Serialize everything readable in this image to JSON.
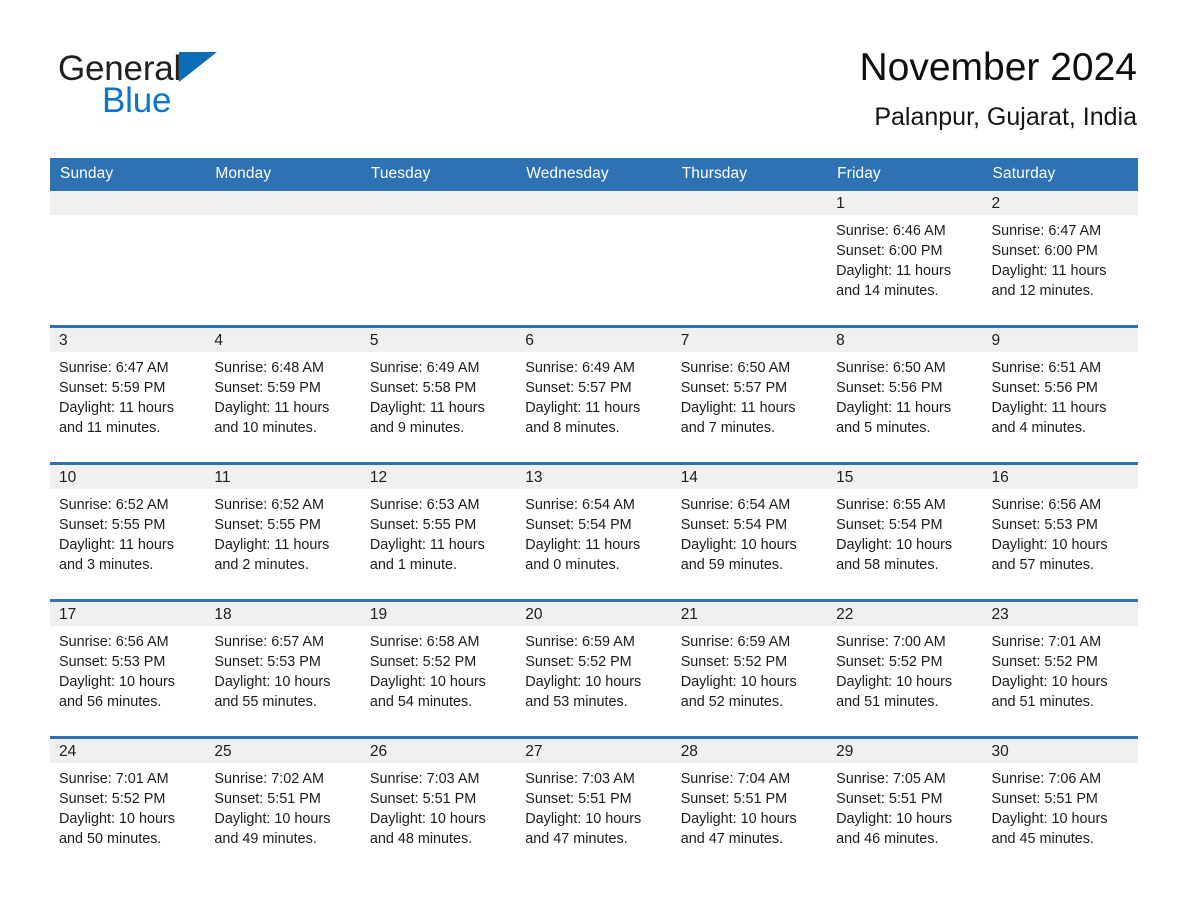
{
  "logo": {
    "word1": "General",
    "word2": "Blue",
    "triangle_icon": "triangle-icon",
    "color_black": "#231f20",
    "color_blue": "#0b76cf"
  },
  "header": {
    "title": "November 2024",
    "subtitle": "Palanpur, Gujarat, India"
  },
  "theme": {
    "header_blue": "#2f72b4",
    "daystrip_gray": "#f0f0f0",
    "text": "#1c1c1c"
  },
  "weekday_headers": [
    "Sunday",
    "Monday",
    "Tuesday",
    "Wednesday",
    "Thursday",
    "Friday",
    "Saturday"
  ],
  "weeks": [
    [
      {
        "day": "",
        "lines": []
      },
      {
        "day": "",
        "lines": []
      },
      {
        "day": "",
        "lines": []
      },
      {
        "day": "",
        "lines": []
      },
      {
        "day": "",
        "lines": []
      },
      {
        "day": "1",
        "lines": [
          "Sunrise: 6:46 AM",
          "Sunset: 6:00 PM",
          "Daylight: 11 hours",
          "and 14 minutes."
        ]
      },
      {
        "day": "2",
        "lines": [
          "Sunrise: 6:47 AM",
          "Sunset: 6:00 PM",
          "Daylight: 11 hours",
          "and 12 minutes."
        ]
      }
    ],
    [
      {
        "day": "3",
        "lines": [
          "Sunrise: 6:47 AM",
          "Sunset: 5:59 PM",
          "Daylight: 11 hours",
          "and 11 minutes."
        ]
      },
      {
        "day": "4",
        "lines": [
          "Sunrise: 6:48 AM",
          "Sunset: 5:59 PM",
          "Daylight: 11 hours",
          "and 10 minutes."
        ]
      },
      {
        "day": "5",
        "lines": [
          "Sunrise: 6:49 AM",
          "Sunset: 5:58 PM",
          "Daylight: 11 hours",
          "and 9 minutes."
        ]
      },
      {
        "day": "6",
        "lines": [
          "Sunrise: 6:49 AM",
          "Sunset: 5:57 PM",
          "Daylight: 11 hours",
          "and 8 minutes."
        ]
      },
      {
        "day": "7",
        "lines": [
          "Sunrise: 6:50 AM",
          "Sunset: 5:57 PM",
          "Daylight: 11 hours",
          "and 7 minutes."
        ]
      },
      {
        "day": "8",
        "lines": [
          "Sunrise: 6:50 AM",
          "Sunset: 5:56 PM",
          "Daylight: 11 hours",
          "and 5 minutes."
        ]
      },
      {
        "day": "9",
        "lines": [
          "Sunrise: 6:51 AM",
          "Sunset: 5:56 PM",
          "Daylight: 11 hours",
          "and 4 minutes."
        ]
      }
    ],
    [
      {
        "day": "10",
        "lines": [
          "Sunrise: 6:52 AM",
          "Sunset: 5:55 PM",
          "Daylight: 11 hours",
          "and 3 minutes."
        ]
      },
      {
        "day": "11",
        "lines": [
          "Sunrise: 6:52 AM",
          "Sunset: 5:55 PM",
          "Daylight: 11 hours",
          "and 2 minutes."
        ]
      },
      {
        "day": "12",
        "lines": [
          "Sunrise: 6:53 AM",
          "Sunset: 5:55 PM",
          "Daylight: 11 hours",
          "and 1 minute."
        ]
      },
      {
        "day": "13",
        "lines": [
          "Sunrise: 6:54 AM",
          "Sunset: 5:54 PM",
          "Daylight: 11 hours",
          "and 0 minutes."
        ]
      },
      {
        "day": "14",
        "lines": [
          "Sunrise: 6:54 AM",
          "Sunset: 5:54 PM",
          "Daylight: 10 hours",
          "and 59 minutes."
        ]
      },
      {
        "day": "15",
        "lines": [
          "Sunrise: 6:55 AM",
          "Sunset: 5:54 PM",
          "Daylight: 10 hours",
          "and 58 minutes."
        ]
      },
      {
        "day": "16",
        "lines": [
          "Sunrise: 6:56 AM",
          "Sunset: 5:53 PM",
          "Daylight: 10 hours",
          "and 57 minutes."
        ]
      }
    ],
    [
      {
        "day": "17",
        "lines": [
          "Sunrise: 6:56 AM",
          "Sunset: 5:53 PM",
          "Daylight: 10 hours",
          "and 56 minutes."
        ]
      },
      {
        "day": "18",
        "lines": [
          "Sunrise: 6:57 AM",
          "Sunset: 5:53 PM",
          "Daylight: 10 hours",
          "and 55 minutes."
        ]
      },
      {
        "day": "19",
        "lines": [
          "Sunrise: 6:58 AM",
          "Sunset: 5:52 PM",
          "Daylight: 10 hours",
          "and 54 minutes."
        ]
      },
      {
        "day": "20",
        "lines": [
          "Sunrise: 6:59 AM",
          "Sunset: 5:52 PM",
          "Daylight: 10 hours",
          "and 53 minutes."
        ]
      },
      {
        "day": "21",
        "lines": [
          "Sunrise: 6:59 AM",
          "Sunset: 5:52 PM",
          "Daylight: 10 hours",
          "and 52 minutes."
        ]
      },
      {
        "day": "22",
        "lines": [
          "Sunrise: 7:00 AM",
          "Sunset: 5:52 PM",
          "Daylight: 10 hours",
          "and 51 minutes."
        ]
      },
      {
        "day": "23",
        "lines": [
          "Sunrise: 7:01 AM",
          "Sunset: 5:52 PM",
          "Daylight: 10 hours",
          "and 51 minutes."
        ]
      }
    ],
    [
      {
        "day": "24",
        "lines": [
          "Sunrise: 7:01 AM",
          "Sunset: 5:52 PM",
          "Daylight: 10 hours",
          "and 50 minutes."
        ]
      },
      {
        "day": "25",
        "lines": [
          "Sunrise: 7:02 AM",
          "Sunset: 5:51 PM",
          "Daylight: 10 hours",
          "and 49 minutes."
        ]
      },
      {
        "day": "26",
        "lines": [
          "Sunrise: 7:03 AM",
          "Sunset: 5:51 PM",
          "Daylight: 10 hours",
          "and 48 minutes."
        ]
      },
      {
        "day": "27",
        "lines": [
          "Sunrise: 7:03 AM",
          "Sunset: 5:51 PM",
          "Daylight: 10 hours",
          "and 47 minutes."
        ]
      },
      {
        "day": "28",
        "lines": [
          "Sunrise: 7:04 AM",
          "Sunset: 5:51 PM",
          "Daylight: 10 hours",
          "and 47 minutes."
        ]
      },
      {
        "day": "29",
        "lines": [
          "Sunrise: 7:05 AM",
          "Sunset: 5:51 PM",
          "Daylight: 10 hours",
          "and 46 minutes."
        ]
      },
      {
        "day": "30",
        "lines": [
          "Sunrise: 7:06 AM",
          "Sunset: 5:51 PM",
          "Daylight: 10 hours",
          "and 45 minutes."
        ]
      }
    ]
  ]
}
